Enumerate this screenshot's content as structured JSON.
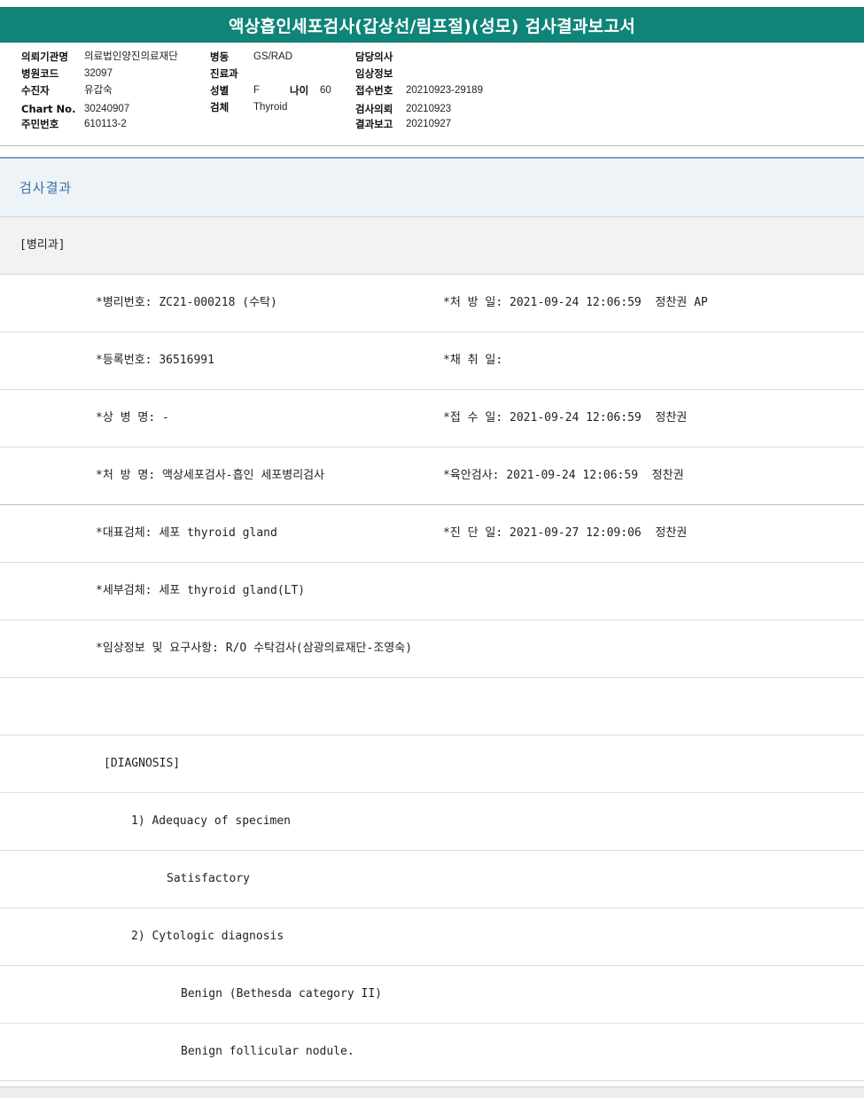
{
  "report": {
    "title": "액상흡인세포검사(갑상선/림프절)(성모) 검사결과보고서"
  },
  "patient_info": {
    "institution_label": "의뢰기관명",
    "institution_value": "의료법인양진의료재단",
    "hospital_code_label": "병원코드",
    "hospital_code_value": "32097",
    "examinee_label": "수진자",
    "examinee_value": "유갑숙",
    "chart_no_label": "Chart No.",
    "chart_no_value": "30240907",
    "resident_no_label": "주민번호",
    "resident_no_value": "610113-2",
    "ward_label": "병동",
    "ward_value": "GS/RAD",
    "department_label": "진료과",
    "department_value": "",
    "sex_label": "성별",
    "sex_value": "F",
    "age_label": "나이",
    "age_value": "60",
    "specimen_label": "검체",
    "specimen_value": "Thyroid",
    "doctor_label": "담당의사",
    "doctor_value": "",
    "clinical_info_label": "임상정보",
    "clinical_info_value": "",
    "receipt_no_label": "접수번호",
    "receipt_no_value": "20210923-29189",
    "request_date_label": "검사의뢰",
    "request_date_value": "20210923",
    "report_date_label": "결과보고",
    "report_date_value": "20210927"
  },
  "results": {
    "section_title": "검사결과",
    "rows": [
      {
        "left": "[병리과]",
        "right": ""
      },
      {
        "left": "*병리번호: ZC21-000218 (수탁)",
        "right": "*처 방 일: 2021-09-24 12:06:59  정찬권 AP"
      },
      {
        "left": "*등록번호: 36516991",
        "right": "*채 취 일:"
      },
      {
        "left": "*상 병 명: -",
        "right": "*접 수 일: 2021-09-24 12:06:59  정찬권"
      },
      {
        "left": "*처 방 명: 액상세포검사-흡인 세포병리검사",
        "right": "*육안검사: 2021-09-24 12:06:59  정찬권"
      },
      {
        "left": "*대표검체: 세포 thyroid gland",
        "right": "*진 단 일: 2021-09-27 12:09:06  정찬권"
      },
      {
        "left": "*세부검체: 세포 thyroid gland(LT)",
        "right": ""
      },
      {
        "left": "*임상정보 및 요구사항: R/O 수탁검사(삼광의료재단-조영숙)",
        "right": ""
      },
      {
        "left": "",
        "right": ""
      },
      {
        "left": "[DIAGNOSIS]",
        "right": ""
      },
      {
        "left": "1) Adequacy of specimen",
        "right": ""
      },
      {
        "left": "Satisfactory",
        "right": ""
      },
      {
        "left": "2) Cytologic diagnosis",
        "right": ""
      },
      {
        "left": "Benign (Bethesda category II)",
        "right": ""
      },
      {
        "left": "Benign follicular nodule.",
        "right": ""
      }
    ]
  }
}
